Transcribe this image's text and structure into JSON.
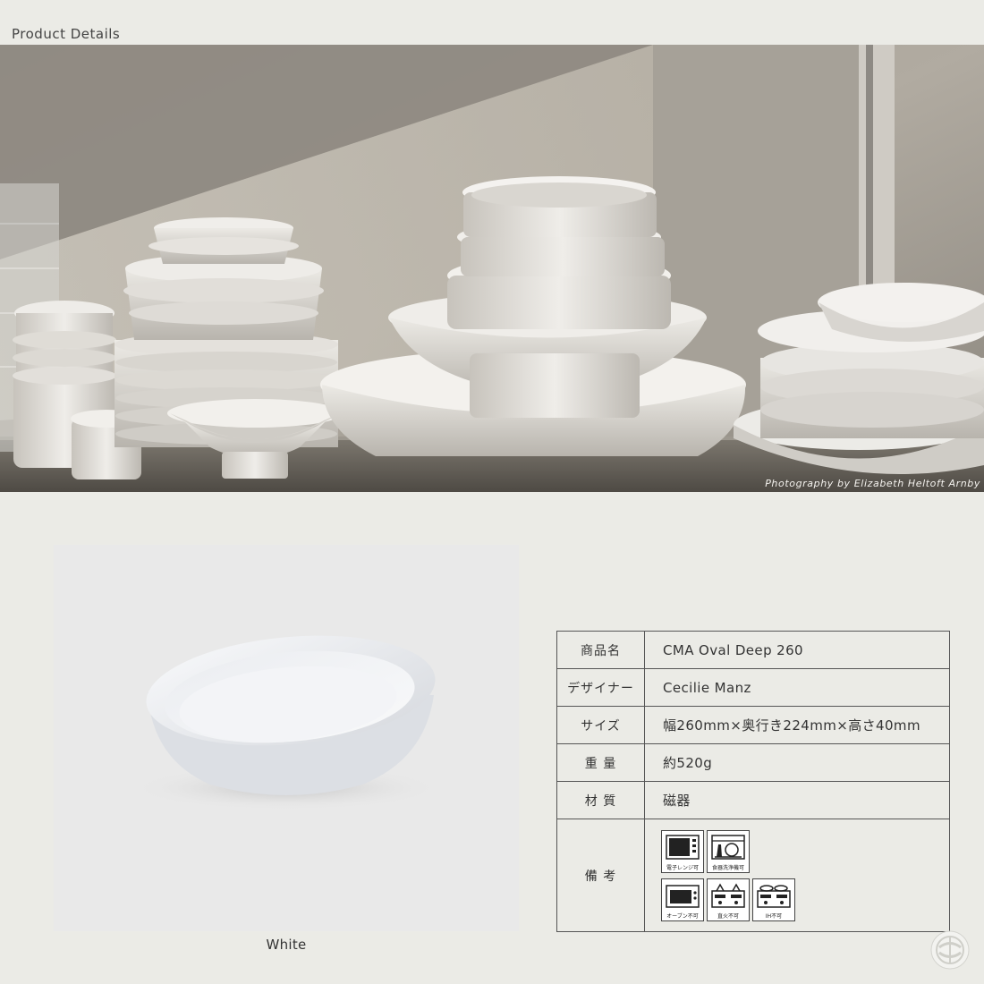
{
  "header": {
    "label": "Product Details"
  },
  "hero": {
    "credit": "Photography by Elizabeth Heltoft Arnby"
  },
  "product": {
    "color_caption": "White"
  },
  "specs": {
    "rows": [
      {
        "label": "商品名",
        "value": "CMA Oval Deep 260"
      },
      {
        "label": "デザイナー",
        "value": "Cecilie Manz"
      },
      {
        "label": "サイズ",
        "value": "幅260mm×奥行き224mm×高さ40mm"
      },
      {
        "label": "重 量",
        "value": "約520g"
      },
      {
        "label": "材 質",
        "value": "磁器"
      }
    ],
    "notes_label": "備 考",
    "icons": [
      {
        "name": "microwave-ok-icon",
        "caption": "電子レンジ可"
      },
      {
        "name": "dishwasher-ok-icon",
        "caption": "食器洗浄機可"
      },
      {
        "name": "oven-not-ok-icon",
        "caption": "オーブン不可"
      },
      {
        "name": "direct-fire-not-ok-icon",
        "caption": "直火不可"
      },
      {
        "name": "ih-not-ok-icon",
        "caption": "IH不可"
      }
    ]
  },
  "colors": {
    "background": "#ebebe6",
    "border": "#555555"
  }
}
